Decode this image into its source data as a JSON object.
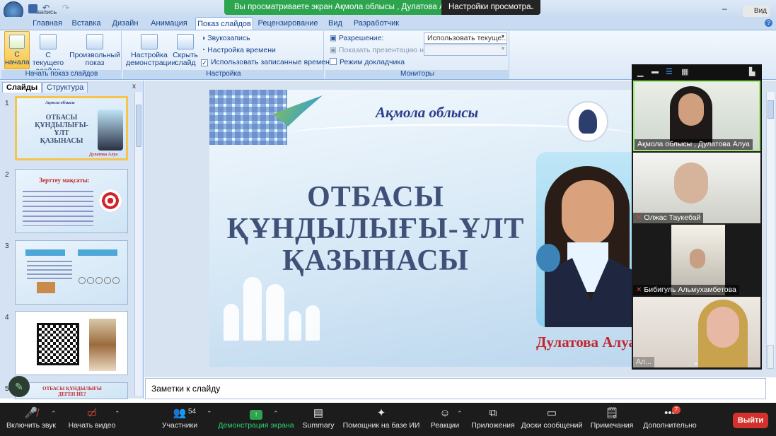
{
  "ribbon": {
    "tabs": [
      "Главная",
      "Вставка",
      "Дизайн",
      "Анимация",
      "Показ слайдов",
      "Рецензирование",
      "Вид",
      "Разработчик"
    ],
    "active_tab": "Показ слайдов",
    "qat_label": "запись",
    "top_right": "Вид",
    "group1": {
      "from_start": "С начала",
      "from_current": "С текущего слайда",
      "custom": "Произвольный показ",
      "label": "Начать показ слайдов"
    },
    "group2": {
      "setup": "Настройка демонстрации",
      "hide": "Скрыть слайд",
      "record": "Звукозапись",
      "rehearse": "Настройка времени",
      "use_timings": "Использовать записанные времена",
      "label": "Настройка"
    },
    "group3": {
      "resolution": "Разрешение:",
      "resolution_value": "Использовать текуще...",
      "show_on": "Показать презентацию на:",
      "presenter": "Режим докладчика",
      "label": "Мониторы"
    }
  },
  "share_banner": {
    "text": "Вы просматриваете экран Ақмола облысы , Дулатова Алуа",
    "button": "Настройки просмотра"
  },
  "slides_pane": {
    "tab_slides": "Слайды",
    "tab_outline": "Структура",
    "close": "x",
    "thumbs": [
      {
        "num": "1",
        "title": "ОТБАСЫ ҚҰНДЫЛЫҒЫ-ҰЛТ ҚАЗЫНАСЫ",
        "region": "Ақмола облысы",
        "author": "Дулатова Алуа"
      },
      {
        "num": "2",
        "title": "Зерттеу мақсаты:"
      },
      {
        "num": "3"
      },
      {
        "num": "4"
      },
      {
        "num": "5",
        "title": "ОТБАСЫ ҚҰНДЫЛЫҒЫ ДЕГЕН НЕ?"
      }
    ]
  },
  "slide": {
    "region": "Ақмола облысы",
    "title_line1": "ОТБАСЫ",
    "title_line2": "ҚҰНДЫЛЫҒЫ-ҰЛТ",
    "title_line3": "ҚАЗЫНАСЫ",
    "author": "Дулатова Алуа"
  },
  "notes": "Заметки к слайду",
  "participants": [
    {
      "name": "Ақмола облысы , Дулатова Алуа",
      "muted": false
    },
    {
      "name": "Олжас Таукебай",
      "muted": true
    },
    {
      "name": "Бибигуль Альмухамбетова",
      "muted": true
    },
    {
      "name": "Ал...",
      "muted": false
    }
  ],
  "toolbar": {
    "mute": "Включить звук",
    "video": "Начать видео",
    "participants": "Участники",
    "participants_count": "54",
    "share": "Демонстрация экрана",
    "summary": "Summary",
    "assistant": "Помощник на базе ИИ",
    "reactions": "Реакции",
    "apps": "Приложения",
    "boards": "Доски сообщений",
    "notes": "Примечания",
    "more": "Дополнительно",
    "more_badge": "7",
    "leave": "Выйти"
  },
  "colors": {
    "share_green": "#2da44e",
    "leave_red": "#d3312b",
    "title_blue": "#3f5178",
    "author_red": "#c1272d"
  }
}
